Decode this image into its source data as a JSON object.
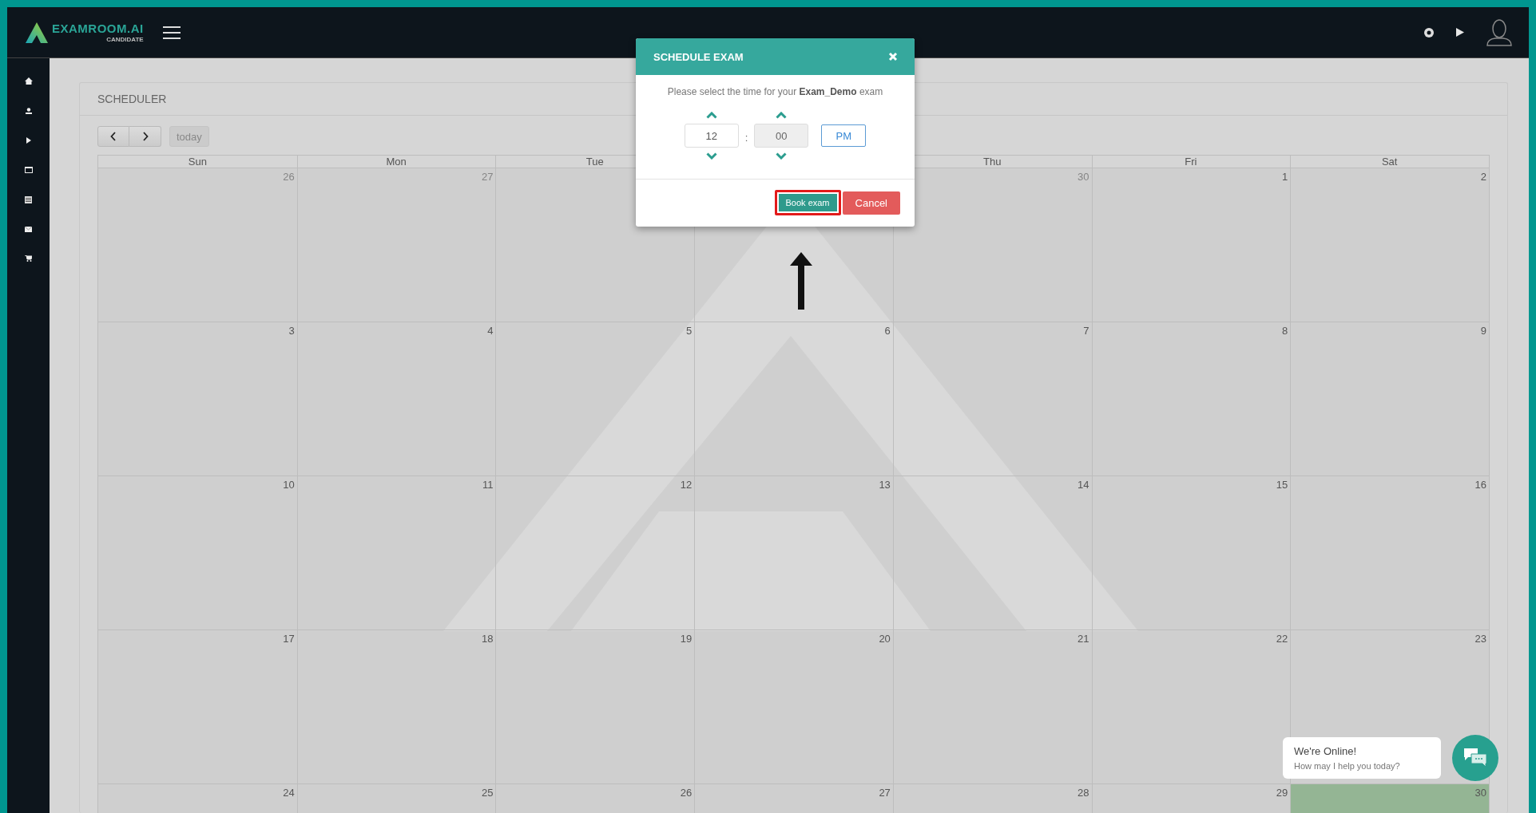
{
  "header": {
    "logo_text": "EXAMROOM.AI",
    "logo_subtext": "CANDIDATE"
  },
  "scheduler": {
    "title": "SCHEDULER",
    "today_button": "today"
  },
  "calendar": {
    "weekdays": [
      "Sun",
      "Mon",
      "Tue",
      "Thu",
      "Fri",
      "Sat"
    ],
    "weeks": [
      [
        {
          "date": "26",
          "other_month": true,
          "today": false
        },
        {
          "date": "27",
          "other_month": true,
          "today": false
        },
        {
          "today": false
        },
        {
          "today": false
        },
        {
          "date": "30",
          "other_month": true,
          "today": false
        },
        {
          "date": "1",
          "other_month": false,
          "today": false
        },
        {
          "date": "2",
          "other_month": false,
          "today": false
        }
      ],
      [
        {
          "date": "3",
          "other_month": false,
          "today": false
        },
        {
          "date": "4",
          "other_month": false,
          "today": false
        },
        {
          "date": "5",
          "other_month": false,
          "today": false
        },
        {
          "date": "6",
          "other_month": false,
          "today": false
        },
        {
          "date": "7",
          "other_month": false,
          "today": false
        },
        {
          "date": "8",
          "other_month": false,
          "today": false
        },
        {
          "date": "9",
          "other_month": false,
          "today": false
        }
      ],
      [
        {
          "date": "10",
          "other_month": false,
          "today": false
        },
        {
          "date": "11",
          "other_month": false,
          "today": false
        },
        {
          "date": "12",
          "other_month": false,
          "today": false
        },
        {
          "date": "13",
          "other_month": false,
          "today": false
        },
        {
          "date": "14",
          "other_month": false,
          "today": false
        },
        {
          "date": "15",
          "other_month": false,
          "today": false
        },
        {
          "date": "16",
          "other_month": false,
          "today": false
        }
      ],
      [
        {
          "date": "17",
          "other_month": false,
          "today": false
        },
        {
          "date": "18",
          "other_month": false,
          "today": false
        },
        {
          "date": "19",
          "other_month": false,
          "today": false
        },
        {
          "date": "20",
          "other_month": false,
          "today": false
        },
        {
          "date": "21",
          "other_month": false,
          "today": false
        },
        {
          "date": "22",
          "other_month": false,
          "today": false
        },
        {
          "date": "23",
          "other_month": false,
          "today": false
        }
      ],
      [
        {
          "date": "24",
          "other_month": false,
          "today": false
        },
        {
          "date": "25",
          "other_month": false,
          "today": false
        },
        {
          "date": "26",
          "other_month": false,
          "today": false
        },
        {
          "date": "27",
          "other_month": false,
          "today": false
        },
        {
          "date": "28",
          "other_month": false,
          "today": false
        },
        {
          "date": "29",
          "other_month": false,
          "today": false
        },
        {
          "date": "30",
          "other_month": false,
          "today": true
        }
      ]
    ]
  },
  "modal": {
    "title": "SCHEDULE EXAM",
    "message": "Please select the time for your **Exam_Demo** exam",
    "hour": {
      "value": "12",
      "disabled": false
    },
    "separator": ":",
    "minute": {
      "value": "00",
      "disabled": true
    },
    "period": "PM",
    "book_button": "Book exam",
    "cancel_button": "Cancel"
  },
  "chat": {
    "title": "We're Online!",
    "subtitle": "How may I help you today?"
  }
}
